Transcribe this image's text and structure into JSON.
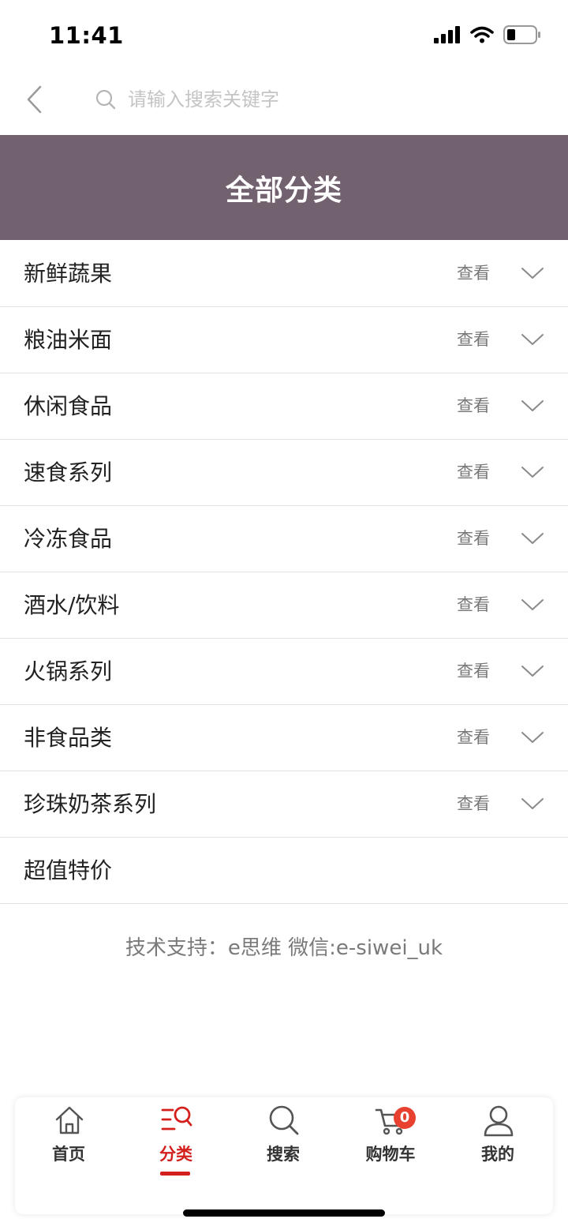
{
  "status_bar": {
    "time": "11:41"
  },
  "search": {
    "placeholder": "请输入搜索关键字",
    "value": ""
  },
  "banner": {
    "title": "全部分类"
  },
  "categories": [
    {
      "name": "新鲜蔬果",
      "action": "查看"
    },
    {
      "name": "粮油米面",
      "action": "查看"
    },
    {
      "name": "休闲食品",
      "action": "查看"
    },
    {
      "name": "速食系列",
      "action": "查看"
    },
    {
      "name": "冷冻食品",
      "action": "查看"
    },
    {
      "name": "酒水/饮料",
      "action": "查看"
    },
    {
      "name": "火锅系列",
      "action": "查看"
    },
    {
      "name": "非食品类",
      "action": "查看"
    },
    {
      "name": "珍珠奶茶系列",
      "action": "查看"
    },
    {
      "name": "超值特价"
    }
  ],
  "footer": {
    "text": "技术支持：e思维 微信:e-siwei_uk"
  },
  "tab_bar": {
    "tabs": [
      {
        "label": "首页",
        "icon": "home-icon"
      },
      {
        "label": "分类",
        "icon": "category-icon",
        "active": true
      },
      {
        "label": "搜索",
        "icon": "search-icon"
      },
      {
        "label": "购物车",
        "icon": "cart-icon",
        "badge": "0"
      },
      {
        "label": "我的",
        "icon": "user-icon"
      }
    ]
  },
  "colors": {
    "banner": "#72616e",
    "accent": "#d4201c",
    "badge": "#e8412f"
  }
}
